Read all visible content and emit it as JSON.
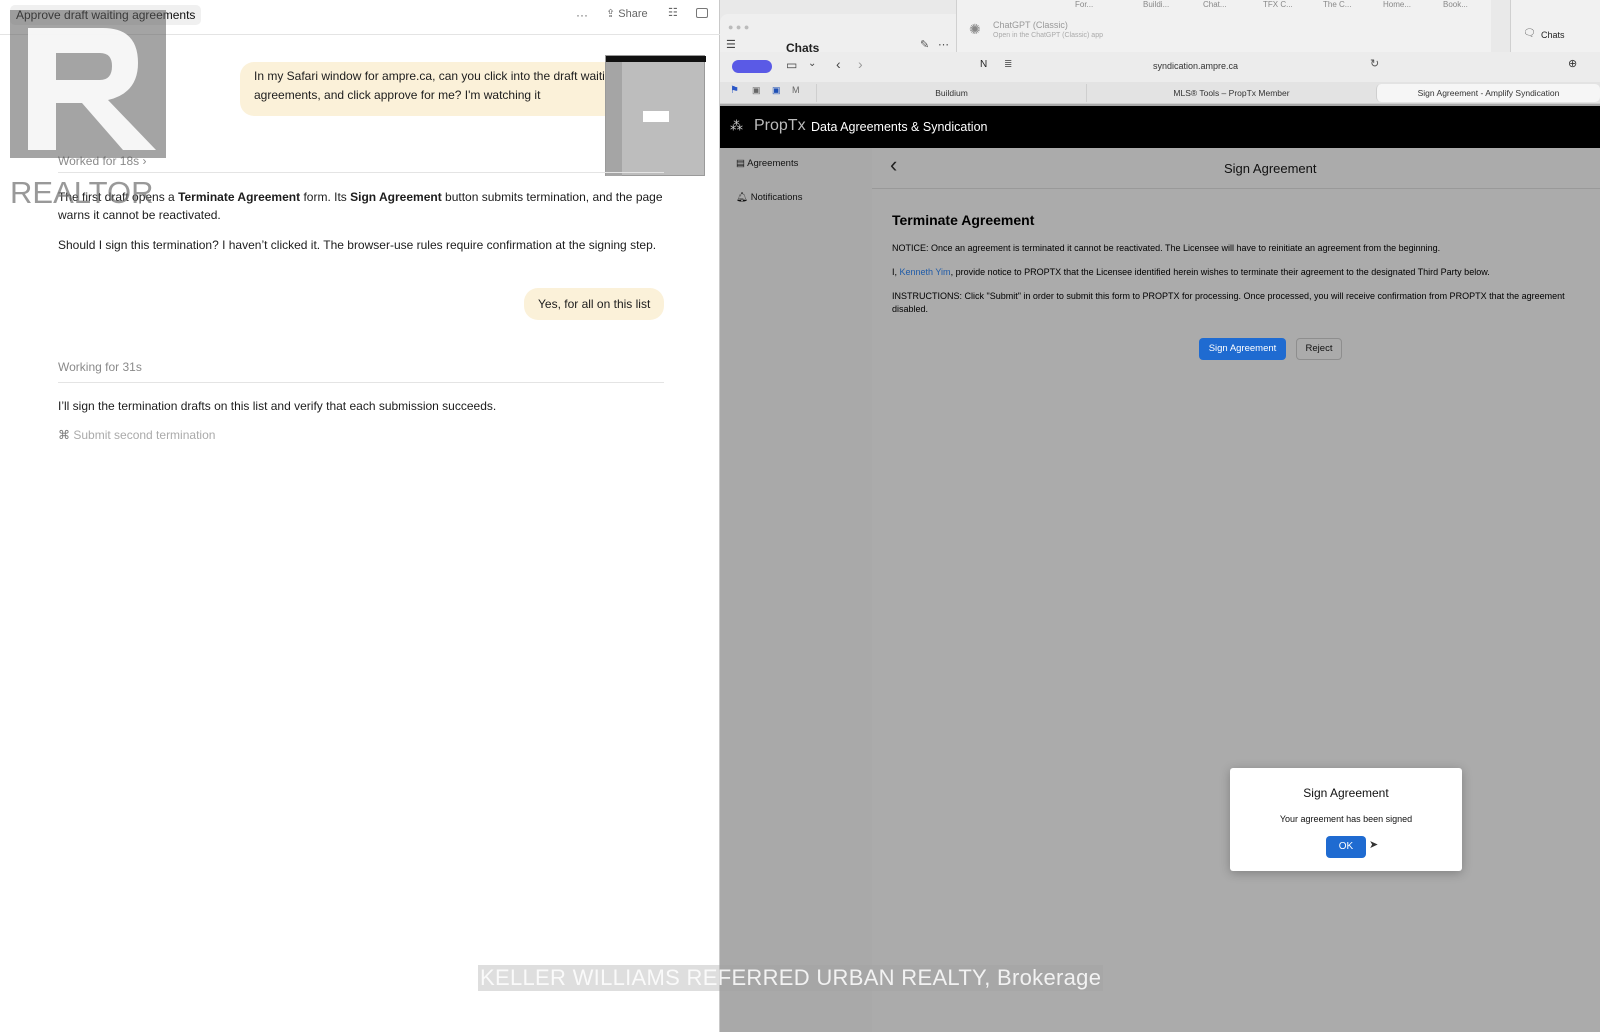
{
  "chat": {
    "title": "Approve draft waiting agreements",
    "toolbar": {
      "more": "···",
      "share": "Share"
    },
    "user_message_1": "In my Safari window for ampre.ca, can you click into the draft waiting agreements, and click approve for me? I'm watching it",
    "worked_for": "Worked for 18s",
    "assistant_p1_a": "The first draft opens a ",
    "assistant_p1_b": "Terminate Agreement",
    "assistant_p1_c": " form. Its ",
    "assistant_p1_d": "Sign Agreement",
    "assistant_p1_e": " button submits termination, and the page warns it cannot be reactivated.",
    "assistant_p2": "Should I sign this termination? I haven’t clicked it. The browser-use rules require confirmation at the signing step.",
    "user_message_2": "Yes, for all on this list",
    "working_for": "Working for 31s",
    "assistant_p3": "I’ll sign the termination drafts on this list and verify that each submission succeeds.",
    "step": "Submit second termination"
  },
  "browser": {
    "chats_title": "Chats",
    "gpt_app_name": "ChatGPT (Classic)",
    "gpt_app_sub": "Open in the ChatGPT (Classic) app",
    "chats_right": "Chats",
    "top_tabs": [
      "For...",
      "Buildi...",
      "Chat...",
      "TFX C...",
      "The C...",
      "Home...",
      "Book..."
    ],
    "url": "syndication.ampre.ca",
    "tabs": [
      "Buildium",
      "MLS® Tools – PropTx Member",
      "Sign Agreement - Amplify Syndication"
    ],
    "active_tab_index": 2
  },
  "proptx": {
    "logo": "PropTx",
    "app_title": "Data Agreements & Syndication",
    "nav": [
      "Agreements",
      "Notifications"
    ],
    "page_title": "Sign Agreement",
    "form_title": "Terminate Agreement",
    "notice": "NOTICE: Once an agreement is terminated it cannot be reactivated. The Licensee will have to reinitiate an agreement from the beginning.",
    "name_pre": "I, ",
    "name": "Kenneth Yim",
    "name_post": ", provide notice to PROPTX that the Licensee identified herein wishes to terminate their agreement to the designated Third Party below.",
    "instructions": "INSTRUCTIONS: Click \"Submit\" in order to submit this form to PROPTX for processing. Once processed, you will receive confirmation from PROPTX that the agreement disabled.",
    "sign_button": "Sign Agreement",
    "reject_button": "Reject"
  },
  "modal": {
    "title": "Sign Agreement",
    "message": "Your agreement has been signed",
    "ok": "OK"
  },
  "watermark": {
    "logo_text": "REALTOR",
    "brokerage": "KELLER WILLIAMS REFERRED URBAN REALTY, Brokerage"
  },
  "colors": {
    "accent": "#1f6bd1",
    "bubble": "#fbf1d9",
    "link": "#1f5ba8"
  }
}
